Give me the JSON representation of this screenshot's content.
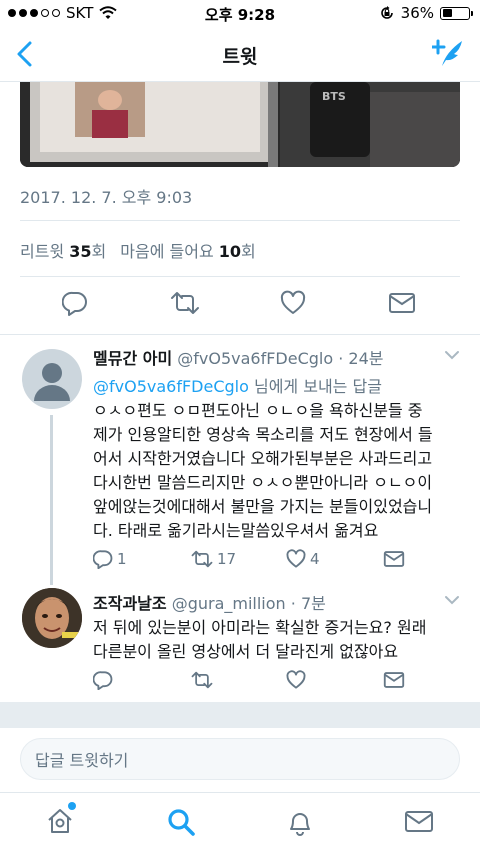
{
  "status_bar": {
    "carrier": "SKT",
    "time": "오후 9:28",
    "battery": "36%",
    "battery_level": 0.36
  },
  "nav": {
    "title": "트윗"
  },
  "tweet": {
    "timestamp": "2017. 12. 7. 오후 9:03",
    "retweets_label": "리트윗",
    "retweets_count": "35",
    "retweets_unit": "회",
    "likes_label": "마음에 들어요",
    "likes_count": "10",
    "likes_unit": "회",
    "media_text": "BTS"
  },
  "replies": [
    {
      "name": "멜뮤간 아미",
      "handle": "@fvO5va6fFDeCglo",
      "time": "· 24분",
      "reply_to_handle": "@fvO5va6fFDeCglo",
      "reply_to_suffix": " 님에게 보내는 답글",
      "text": "ㅇㅅㅇ편도 ㅇㅁ편도아닌 ㅇㄴㅇ을 욕하신분들 중\n제가 인용알티한 영상속 목소리를 저도 현장에서 들\n어서 시작한거였습니다 오해가된부분은 사과드리고\n다시한번 말씀드리지만 ㅇㅅㅇ뿐만아니라 ㅇㄴㅇ이\n앞에앉는것에대해서 불만을 가지는 분들이있었습니\n다. 타래로 옮기라시는말씀있우셔서 옮겨요",
      "reply_count": "1",
      "retweet_count": "17",
      "like_count": "4"
    },
    {
      "name": "조작과날조",
      "handle": "@gura_million",
      "time": "· 7분",
      "text": "저 뒤에 있는분이 아미라는 확실한 증거는요? 원래\n다른분이 올린 영상에서 더 달라진게 없잖아요",
      "reply_count": "",
      "retweet_count": "",
      "like_count": ""
    }
  ],
  "composer": {
    "placeholder": "답글 트윗하기"
  },
  "colors": {
    "accent": "#1da1f2",
    "secondary_text": "#657786",
    "divider": "#e1e8ed"
  },
  "icons": [
    "back-arrow-icon",
    "compose-tweet-icon",
    "reply-icon",
    "retweet-icon",
    "like-icon",
    "dm-icon",
    "chevron-down-icon",
    "home-icon",
    "search-icon",
    "notifications-icon",
    "messages-icon"
  ]
}
